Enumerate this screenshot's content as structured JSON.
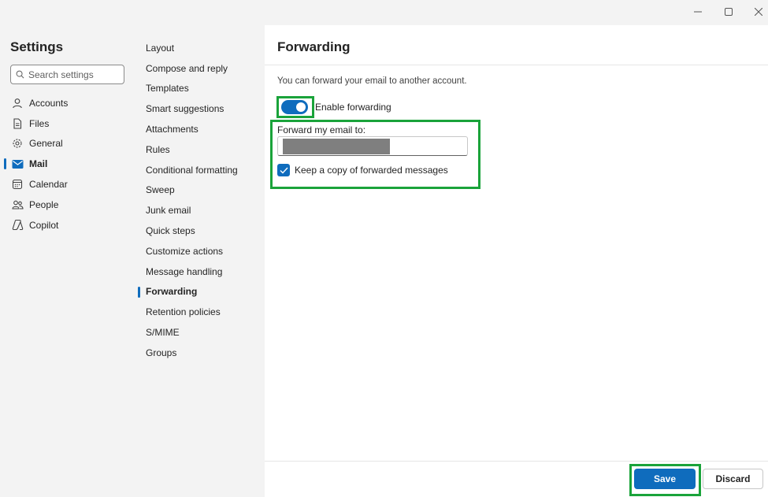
{
  "window": {
    "controls": [
      "minimize-icon",
      "maximize-icon",
      "close-icon"
    ]
  },
  "sidebar": {
    "title": "Settings",
    "search_placeholder": "Search settings",
    "items": [
      {
        "label": "Accounts",
        "icon": "person-icon"
      },
      {
        "label": "Files",
        "icon": "file-icon"
      },
      {
        "label": "General",
        "icon": "gear-icon"
      },
      {
        "label": "Mail",
        "icon": "mail-icon",
        "active": true
      },
      {
        "label": "Calendar",
        "icon": "calendar-icon"
      },
      {
        "label": "People",
        "icon": "people-icon"
      },
      {
        "label": "Copilot",
        "icon": "copilot-icon"
      }
    ]
  },
  "submenu": {
    "items": [
      {
        "label": "Layout"
      },
      {
        "label": "Compose and reply"
      },
      {
        "label": "Templates"
      },
      {
        "label": "Smart suggestions"
      },
      {
        "label": "Attachments"
      },
      {
        "label": "Rules"
      },
      {
        "label": "Conditional formatting"
      },
      {
        "label": "Sweep"
      },
      {
        "label": "Junk email"
      },
      {
        "label": "Quick steps"
      },
      {
        "label": "Customize actions"
      },
      {
        "label": "Message handling"
      },
      {
        "label": "Forwarding",
        "active": true
      },
      {
        "label": "Retention policies"
      },
      {
        "label": "S/MIME"
      },
      {
        "label": "Groups"
      }
    ]
  },
  "content": {
    "title": "Forwarding",
    "description": "You can forward your email to another account.",
    "toggle_label": "Enable forwarding",
    "toggle_on": true,
    "forward_label": "Forward my email to:",
    "forward_value": "",
    "keep_copy_label": "Keep a copy of forwarded messages",
    "keep_copy_checked": true
  },
  "footer": {
    "save_label": "Save",
    "discard_label": "Discard"
  },
  "colors": {
    "accent": "#0f6cbd",
    "highlight": "#1aa33a",
    "redaction": "#7f7f7f"
  }
}
